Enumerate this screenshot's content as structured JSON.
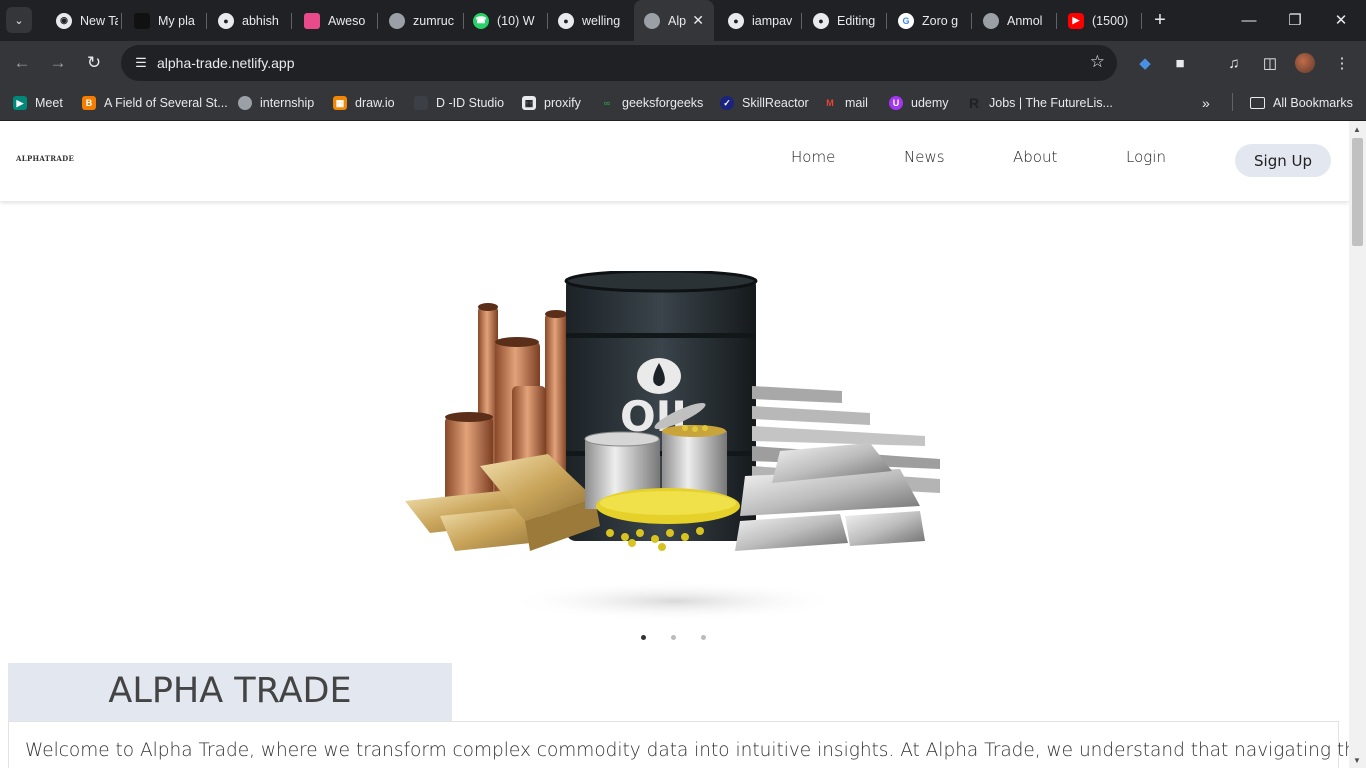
{
  "browser": {
    "tabs": [
      {
        "label": "New Ta",
        "icon": "chrome-icon"
      },
      {
        "label": "My pla",
        "icon": "dark-app-icon"
      },
      {
        "label": "abhish",
        "icon": "github-icon"
      },
      {
        "label": "Aweso",
        "icon": "pink-app-icon"
      },
      {
        "label": "zumruc",
        "icon": "globe-icon"
      },
      {
        "label": "(10) W",
        "icon": "whatsapp-icon"
      },
      {
        "label": "welling",
        "icon": "github-icon"
      },
      {
        "label": "Alp",
        "icon": "globe-icon"
      },
      {
        "label": "iampav",
        "icon": "github-icon"
      },
      {
        "label": "Editing",
        "icon": "github-icon"
      },
      {
        "label": "Zoro g",
        "icon": "google-icon"
      },
      {
        "label": "Anmol",
        "icon": "globe-icon"
      },
      {
        "label": "(1500)",
        "icon": "youtube-icon"
      }
    ],
    "address": "alpha-trade.netlify.app",
    "bookmarks": [
      {
        "label": "Meet",
        "icon": "meet-icon"
      },
      {
        "label": "A Field of Several St...",
        "icon": "blogger-icon"
      },
      {
        "label": "internship",
        "icon": "globe-icon"
      },
      {
        "label": "draw.io",
        "icon": "drawio-icon"
      },
      {
        "label": "D -ID Studio",
        "icon": "did-icon"
      },
      {
        "label": "proxify",
        "icon": "proxify-icon"
      },
      {
        "label": "geeksforgeeks",
        "icon": "gfg-icon"
      },
      {
        "label": "SkillReactor",
        "icon": "skillreactor-icon"
      },
      {
        "label": "mail",
        "icon": "gmail-icon"
      },
      {
        "label": "udemy",
        "icon": "udemy-icon"
      },
      {
        "label": "Jobs | The FutureLis...",
        "icon": "r-icon"
      }
    ],
    "all_bookmarks": "All Bookmarks"
  },
  "site": {
    "logo": "ALPHATRADE",
    "nav": {
      "home": "Home",
      "news": "News",
      "about": "About",
      "login": "Login",
      "signup": "Sign Up"
    },
    "hero_label": "OIL",
    "carousel": {
      "slides": 3,
      "active": 1
    },
    "section_title": "ALPHA TRADE",
    "about_text": "Welcome to Alpha Trade, where we transform complex commodity data into intuitive insights. At Alpha Trade, we understand that navigating the world of"
  },
  "colors": {
    "accent_band": "#e3e8f0",
    "tab_bg": "#202124",
    "toolbar_bg": "#35363a"
  }
}
